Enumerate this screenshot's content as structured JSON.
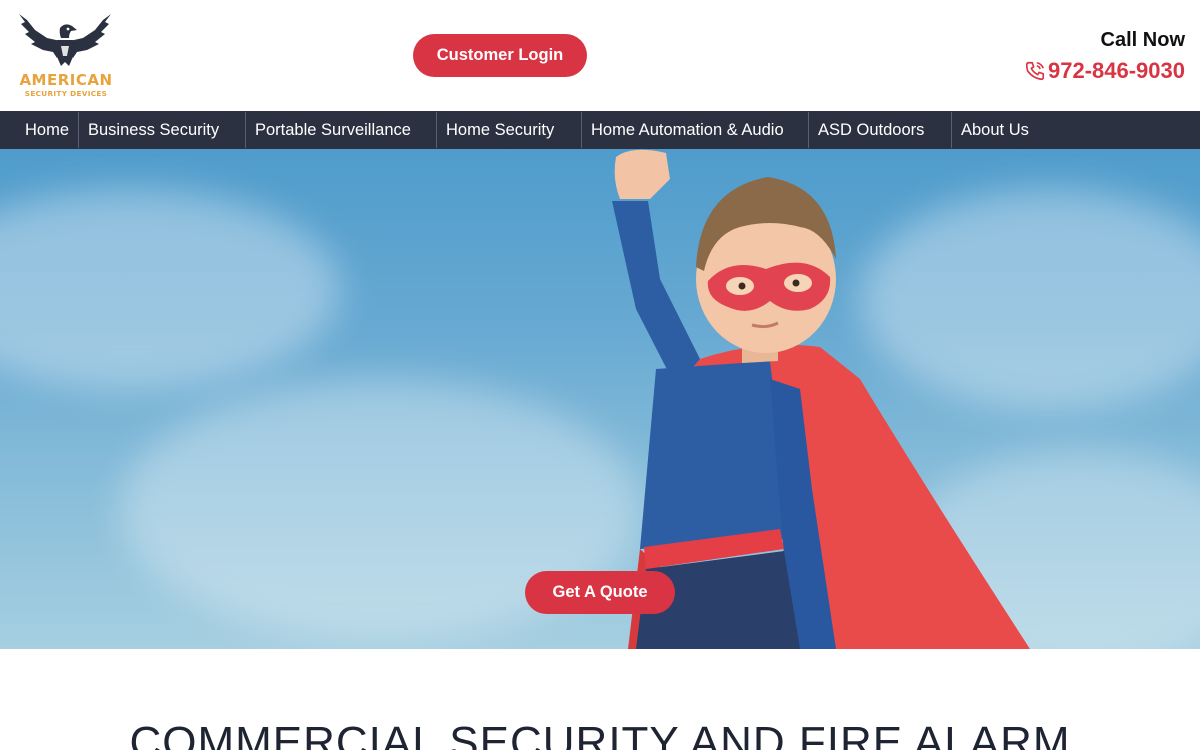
{
  "brand": {
    "logo_word": "AMERICAN",
    "logo_sub": "SECURITY DEVICES",
    "logo_icon": "eagle-icon",
    "colors": {
      "accent": "#d93444",
      "gold": "#e8a33c",
      "navy": "#2b3140"
    }
  },
  "header": {
    "login_label": "Customer Login",
    "call_label": "Call Now",
    "phone": "972-846-9030",
    "phone_icon": "phone-icon"
  },
  "nav": {
    "items": [
      {
        "label": "Home"
      },
      {
        "label": "Business Security"
      },
      {
        "label": "Portable Surveillance"
      },
      {
        "label": "Home Security"
      },
      {
        "label": "Home Automation & Audio"
      },
      {
        "label": "ASD Outdoors"
      },
      {
        "label": "About Us"
      }
    ]
  },
  "hero": {
    "cta_label": "Get A Quote"
  },
  "section": {
    "title": "COMMERCIAL SECURITY AND FIRE ALARM"
  }
}
